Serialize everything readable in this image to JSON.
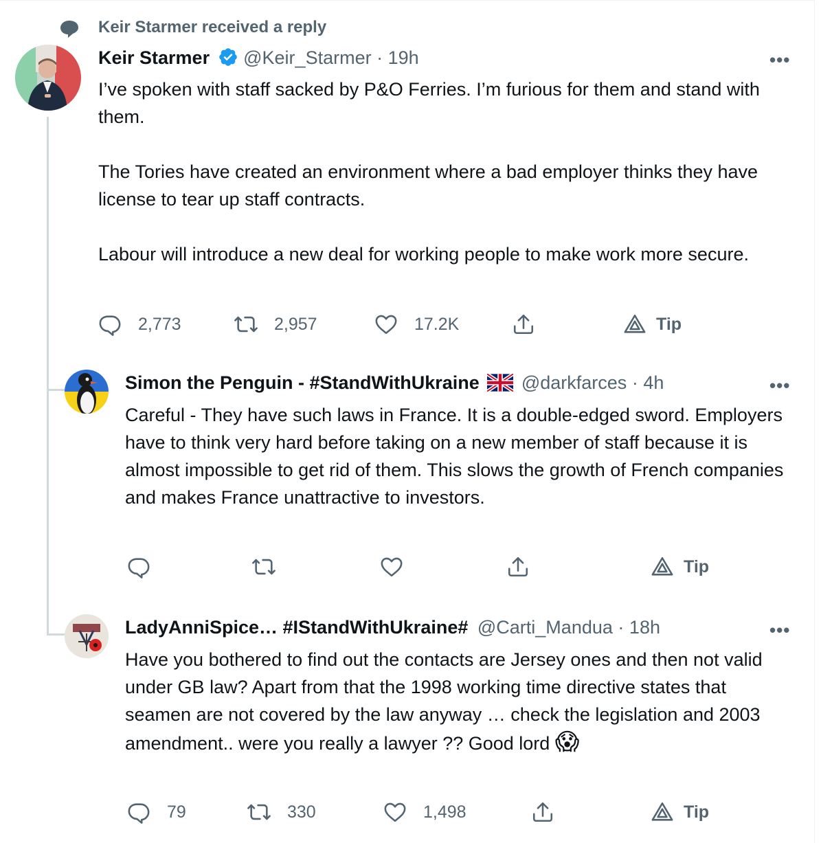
{
  "context": {
    "label": "Keir Starmer received a reply",
    "icon": "speech-bubble-icon"
  },
  "colors": {
    "verified": "#1d9bf0",
    "muted": "#536471",
    "line": "#cfd9de"
  },
  "main_tweet": {
    "name": "Keir Starmer",
    "handle": "@Keir_Starmer",
    "time": "19h",
    "paragraphs": [
      "I’ve spoken with staff sacked by P&O Ferries. I’m furious for them and stand with them.",
      "The Tories have created an environment where a bad employer thinks they have license to tear up staff contracts.",
      "Labour will introduce a new deal for working people to make work more secure."
    ],
    "replies": "2,773",
    "retweets": "2,957",
    "likes": "17.2K",
    "tip": "Tip"
  },
  "reply1": {
    "name": "Simon the Penguin - #StandWithUkraine",
    "handle": "@darkfarces",
    "time": "4h",
    "text": "Careful - They have such laws in France. It is a double-edged sword. Employers have to think very hard before taking on a new member of staff because it is almost impossible to get rid of them. This slows the growth of French companies and makes France unattractive to investors.",
    "tip": "Tip"
  },
  "reply2": {
    "name": "LadyAnniSpice… #IStandWithUkraine#",
    "handle": "@Carti_Mandua",
    "time": "18h",
    "text": "Have you bothered to find out the contacts are Jersey ones and then not valid under GB law? Apart from that the 1998 working time directive states that seamen are not covered by the law anyway … check the legislation and 2003 amendment.. were you really a lawyer ?? Good lord",
    "emoji": "😱",
    "replies": "79",
    "retweets": "330",
    "likes": "1,498",
    "tip": "Tip"
  },
  "separator": "·",
  "more": "•••"
}
